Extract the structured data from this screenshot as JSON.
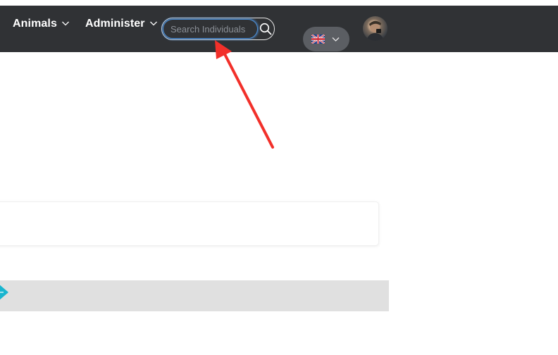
{
  "navbar": {
    "menus": [
      {
        "label": "Animals"
      },
      {
        "label": "Administer"
      }
    ],
    "search": {
      "placeholder": "Search Individuals",
      "value": ""
    },
    "language": {
      "flag_icon": "uk-flag-icon",
      "dropdown_icon": "chevron-down-icon"
    },
    "avatar_icon": "user-avatar"
  },
  "annotation": {
    "arrow_color": "#f2302a"
  },
  "colors": {
    "navbar_bg": "#303235",
    "search_focus": "#4d8fd6",
    "lang_button_bg": "#5b5e63",
    "band_bg": "#e0e0e0",
    "marker": "#19b5cf"
  }
}
